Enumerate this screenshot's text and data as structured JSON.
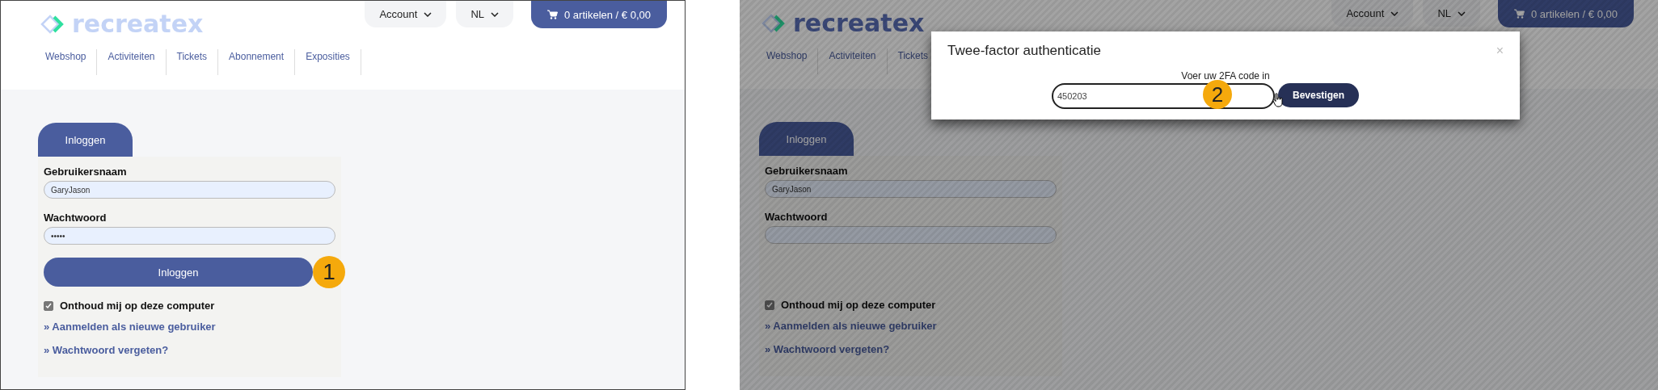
{
  "panels": [
    {
      "logo": "recreatex",
      "account": "Account",
      "language": "NL",
      "cart": "0 artikelen / € 0,00",
      "nav": [
        "Webshop",
        "Activiteiten",
        "Tickets",
        "Abonnement",
        "Exposities"
      ],
      "tab": "Inloggen",
      "fields": [
        {
          "label": "Gebruikersnaam",
          "value": "GaryJason"
        },
        {
          "label": "Wachtwoord",
          "value": "•••••"
        }
      ],
      "login_button": {
        "label": "Inloggen",
        "step": "1"
      },
      "remember": {
        "label": "Onthoud mij op deze computer",
        "checked": true
      },
      "links": [
        "» Aanmelden als nieuwe gebruiker",
        "» Wachtwoord vergeten?"
      ]
    },
    {
      "logo": "recreatex",
      "account": "Account",
      "language": "NL",
      "cart": "0 artikelen / € 0,00",
      "nav": [
        "Webshop",
        "Activiteiten",
        "Tickets"
      ],
      "tab": "Inloggen",
      "fields": [
        {
          "label": "Gebruikersnaam",
          "value": "GaryJason"
        },
        {
          "label": "Wachtwoord"
        }
      ],
      "remember": {
        "label": "Onthoud mij op deze computer",
        "checked": true
      },
      "links": [
        "» Aanmelden als nieuwe gebruiker",
        "» Wachtwoord vergeten?"
      ],
      "modal": {
        "title": "Twee-factor authenticatie",
        "close": "×",
        "prompt": "Voer uw 2FA code in",
        "code": {
          "value": "450203",
          "step": "2"
        },
        "confirm": "Bevestigen"
      }
    }
  ]
}
